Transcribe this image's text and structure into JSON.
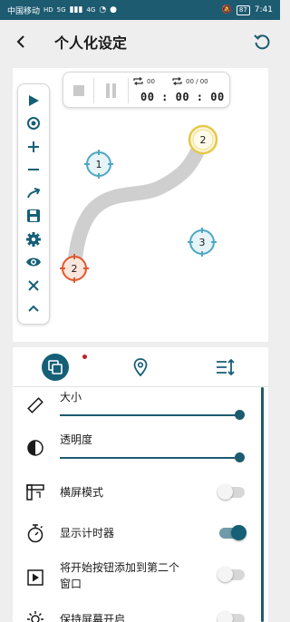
{
  "status_bar": {
    "carrier_1": "中国移动",
    "network_1": "HD",
    "signal_1": "5G",
    "carrier_2": "4G",
    "battery": "87",
    "time": "7:41"
  },
  "app_bar": {
    "title": "个人化设定"
  },
  "preview": {
    "timer": {
      "loop_count": "00",
      "cycle_count": "00 / 00",
      "elapsed": "00 : 00 : 00"
    },
    "targets": [
      {
        "label": "1",
        "style": "blue"
      },
      {
        "label": "2",
        "style": "yellow"
      },
      {
        "label": "3",
        "style": "blue"
      },
      {
        "label": "2",
        "style": "red"
      }
    ]
  },
  "tabs": [
    {
      "icon": "layers-icon",
      "active": true,
      "has_badge": true
    },
    {
      "icon": "location-pin-icon",
      "active": false
    },
    {
      "icon": "sort-sliders-icon",
      "active": false
    }
  ],
  "settings": [
    {
      "label": "大小",
      "type": "slider",
      "value": 1.0
    },
    {
      "label": "透明度",
      "type": "slider",
      "value": 1.0
    },
    {
      "label": "横屏模式",
      "type": "toggle",
      "on": false
    },
    {
      "label": "显示计时器",
      "type": "toggle",
      "on": true
    },
    {
      "label_line1": "将开始按钮添加到第二个",
      "label_line2": "窗口",
      "type": "toggle",
      "on": false
    },
    {
      "label": "保持屏幕开启",
      "type": "toggle",
      "on": false
    }
  ],
  "colors": {
    "primary": "#1c5b70",
    "target_blue": "#4fa7c3",
    "target_yellow": "#e5c84a",
    "target_red": "#e0582c"
  }
}
